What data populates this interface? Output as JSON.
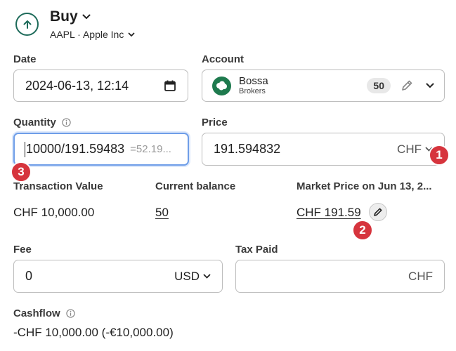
{
  "header": {
    "title": "Buy",
    "subtitle": "AAPL · Apple Inc"
  },
  "date": {
    "label": "Date",
    "value": "2024-06-13, 12:14"
  },
  "account": {
    "label": "Account",
    "name": "Bossa",
    "type": "Brokers",
    "count": "50"
  },
  "quantity": {
    "label": "Quantity",
    "value": "10000/191.59483",
    "hint": "=52.19..."
  },
  "price": {
    "label": "Price",
    "value": "191.594832",
    "currency": "CHF"
  },
  "summary": {
    "transaction_value_label": "Transaction Value",
    "transaction_value": "CHF 10,000.00",
    "current_balance_label": "Current balance",
    "current_balance": "50",
    "market_price_label": "Market Price on Jun 13, 2...",
    "market_price": "CHF 191.59"
  },
  "fee": {
    "label": "Fee",
    "value": "0",
    "currency": "USD"
  },
  "tax": {
    "label": "Tax Paid",
    "currency": "CHF"
  },
  "cashflow": {
    "label": "Cashflow",
    "value": "-CHF 10,000.00 (-€10,000.00)"
  },
  "markers": [
    "1",
    "2",
    "3"
  ],
  "colors": {
    "accent_green": "#1e6b5a",
    "focus_blue": "#6f9ee8",
    "marker_red": "#d6343d"
  }
}
